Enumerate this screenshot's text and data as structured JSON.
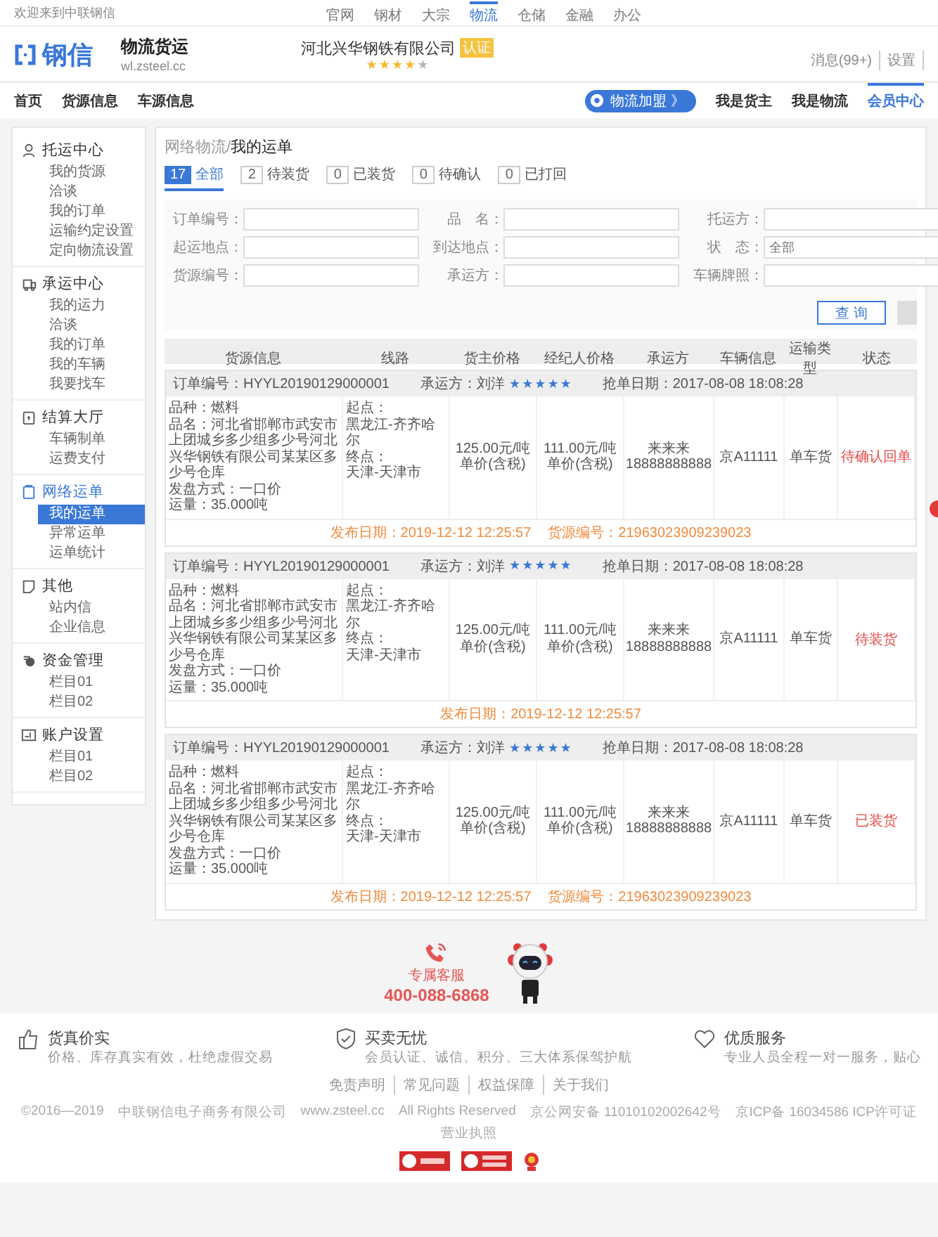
{
  "top_bar": {
    "welcome": "欢迎来到中联钢信",
    "links": [
      {
        "label": "官网",
        "selected": false
      },
      {
        "label": "钢材",
        "selected": false
      },
      {
        "label": "大宗",
        "selected": false
      },
      {
        "label": "物流",
        "selected": true
      },
      {
        "label": "仓储",
        "selected": false
      },
      {
        "label": "金融",
        "selected": false
      },
      {
        "label": "办公",
        "selected": false
      }
    ]
  },
  "header": {
    "logo_text": "钢信",
    "site_title": "物流货运",
    "site_url": "wl.zsteel.cc",
    "company": "河北兴华钢铁有限公司",
    "company_badge": "认证",
    "stars": 4,
    "messages": "消息(99+)",
    "settings": "设置"
  },
  "nav": {
    "left": [
      "首页",
      "货源信息",
      "车源信息"
    ],
    "join_button": "物流加盟",
    "join_arrow": "》",
    "right": [
      {
        "label": "我是货主",
        "selected": false
      },
      {
        "label": "我是物流",
        "selected": false
      },
      {
        "label": "会员中心",
        "selected": true
      }
    ]
  },
  "sidebar": [
    {
      "title": "托运中心",
      "items": [
        {
          "label": "我的货源",
          "selected": false
        },
        {
          "label": "洽谈",
          "selected": false
        },
        {
          "label": "我的订单",
          "selected": false
        },
        {
          "label": "运输约定设置",
          "selected": false
        },
        {
          "label": "定向物流设置",
          "selected": false
        }
      ]
    },
    {
      "title": "承运中心",
      "items": [
        {
          "label": "我的运力",
          "selected": false
        },
        {
          "label": "洽谈",
          "selected": false
        },
        {
          "label": "我的订单",
          "selected": false
        },
        {
          "label": "我的车辆",
          "selected": false
        },
        {
          "label": "我要找车",
          "selected": false
        }
      ]
    },
    {
      "title": "结算大厅",
      "items": [
        {
          "label": "车辆制单",
          "selected": false
        },
        {
          "label": "运费支付",
          "selected": false
        }
      ]
    },
    {
      "title": "网络运单",
      "items": [
        {
          "label": "我的运单",
          "selected": true
        },
        {
          "label": "异常运单",
          "selected": false
        },
        {
          "label": "运单统计",
          "selected": false
        }
      ]
    },
    {
      "title": "其他",
      "items": [
        {
          "label": "站内信",
          "selected": false
        },
        {
          "label": "企业信息",
          "selected": false
        }
      ]
    },
    {
      "title": "资金管理",
      "items": [
        {
          "label": "栏目01",
          "selected": false
        },
        {
          "label": "栏目02",
          "selected": false
        }
      ]
    },
    {
      "title": "账户设置",
      "items": [
        {
          "label": "栏目01",
          "selected": false
        },
        {
          "label": "栏目02",
          "selected": false
        }
      ]
    }
  ],
  "breadcrumb": {
    "parent": "网络物流/",
    "current": "我的运单"
  },
  "tabs": [
    {
      "count": "17",
      "label": "全部",
      "selected": true
    },
    {
      "count": "2",
      "label": "待装货",
      "selected": false
    },
    {
      "count": "0",
      "label": "已装货",
      "selected": false
    },
    {
      "count": "0",
      "label": "待确认",
      "selected": false
    },
    {
      "count": "0",
      "label": "已打回",
      "selected": false
    }
  ],
  "filters": [
    {
      "label": "订单编号："
    },
    {
      "label": "品　名："
    },
    {
      "label": "托运方："
    },
    {
      "label": "起运地点："
    },
    {
      "label": "到达地点："
    },
    {
      "label": "状　态：",
      "placeholder": "全部"
    },
    {
      "label": "货源编号："
    },
    {
      "label": "承运方："
    },
    {
      "label": "车辆牌照："
    }
  ],
  "search_button": "查 询",
  "table": {
    "columns": [
      "货源信息",
      "线路",
      "货主价格",
      "经纪人价格",
      "承运方",
      "车辆信息",
      "运输类型",
      "状态"
    ],
    "orders": [
      {
        "order_no": "订单编号：HYYL20190129000001",
        "carrier_label": "承运方：刘洋",
        "stars": 5,
        "grab_date": "抢单日期：2017-08-08  18:08:28",
        "info": [
          "品种：燃料",
          "品名：河北省邯郸市武安市上团城乡多少组多少号河北兴华钢铁有限公司某某区多少号仓库",
          "发盘方式：一口价",
          "运量：35.000吨"
        ],
        "route": [
          "起点：",
          "黑龙江-齐齐哈尔",
          "终点：",
          "天津-天津市"
        ],
        "owner_price": [
          "125.00元/吨",
          "单价(含税)"
        ],
        "broker_price": [
          "111.00元/吨",
          "单价(含税)"
        ],
        "carrier": [
          "来来来",
          "18888888888"
        ],
        "vehicle": "京A11111",
        "transport_type": "单车货",
        "status": "待确认回单",
        "publish_date": "发布日期：2019-12-12 12:25:57",
        "source_no": "货源编号：21963023909239023"
      },
      {
        "order_no": "订单编号：HYYL20190129000001",
        "carrier_label": "承运方：刘洋",
        "stars": 5,
        "grab_date": "抢单日期：2017-08-08  18:08:28",
        "info": [
          "品种：燃料",
          "品名：河北省邯郸市武安市上团城乡多少组多少号河北兴华钢铁有限公司某某区多少号仓库",
          "发盘方式：一口价",
          "运量：35.000吨"
        ],
        "route": [
          "起点：",
          "黑龙江-齐齐哈尔",
          "终点：",
          "天津-天津市"
        ],
        "owner_price": [
          "125.00元/吨",
          "单价(含税)"
        ],
        "broker_price": [
          "111.00元/吨",
          "单价(含税)"
        ],
        "carrier": [
          "来来来",
          "18888888888"
        ],
        "vehicle": "京A11111",
        "transport_type": "单车货",
        "status": "待装货",
        "publish_date": "发布日期：2019-12-12 12:25:57"
      },
      {
        "order_no": "订单编号：HYYL20190129000001",
        "carrier_label": "承运方：刘洋",
        "stars": 5,
        "grab_date": "抢单日期：2017-08-08  18:08:28",
        "info": [
          "品种：燃料",
          "品名：河北省邯郸市武安市上团城乡多少组多少号河北兴华钢铁有限公司某某区多少号仓库",
          "发盘方式：一口价",
          "运量：35.000吨"
        ],
        "route": [
          "起点：",
          "黑龙江-齐齐哈尔",
          "终点：",
          "天津-天津市"
        ],
        "owner_price": [
          "125.00元/吨",
          "单价(含税)"
        ],
        "broker_price": [
          "111.00元/吨",
          "单价(含税)"
        ],
        "carrier": [
          "来来来",
          "18888888888"
        ],
        "vehicle": "京A11111",
        "transport_type": "单车货",
        "status": "已装货",
        "publish_date": "发布日期：2019-12-12 12:25:57",
        "source_no": "货源编号：21963023909239023"
      }
    ]
  },
  "service": {
    "title": "专属客服",
    "phone": "400-088-6868"
  },
  "features": [
    {
      "title": "货真价实",
      "text": "价格、库存真实有效，杜绝虚假交易"
    },
    {
      "title": "买卖无忧",
      "text": "会员认证、诚信、积分、三大体系保驾护航"
    },
    {
      "title": "优质服务",
      "text": "专业人员全程一对一服务，贴心"
    }
  ],
  "footer_links": [
    "免责声明",
    "常见问题",
    "权益保障",
    "关于我们"
  ],
  "copyright": [
    "©2016—2019",
    "中联钢信电子商务有限公司",
    "www.zsteel.cc",
    "All Rights Reserved",
    "京公网安备 11010102002642号",
    "京ICP备 16034586 ICP许可证",
    "营业执照"
  ]
}
